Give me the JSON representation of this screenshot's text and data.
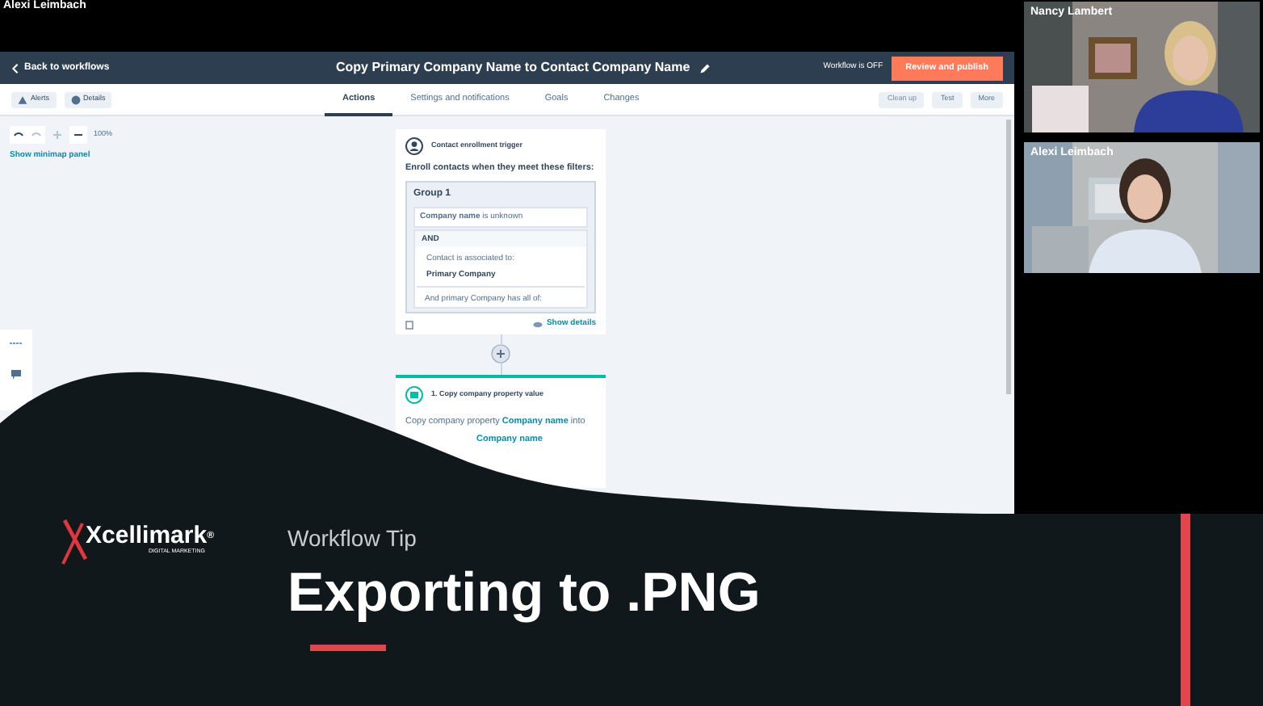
{
  "presenter_label": "Alexi Leimbach",
  "header": {
    "back": "Back to workflows",
    "title": "Copy Primary Company Name to Contact Company Name",
    "status": "Workflow is OFF",
    "publish": "Review and publish"
  },
  "toolbar": {
    "left": [
      {
        "label": "Alerts",
        "kind": "alert"
      },
      {
        "label": "Details",
        "kind": "info"
      }
    ],
    "tabs": [
      {
        "label": "Actions",
        "selected": true
      },
      {
        "label": "Settings and notifications",
        "selected": false
      },
      {
        "label": "Goals",
        "selected": false
      },
      {
        "label": "Changes",
        "selected": false
      }
    ],
    "right": [
      {
        "label": "Clean up",
        "disabled": true
      },
      {
        "label": "Test",
        "disabled": false
      },
      {
        "label": "More",
        "disabled": false
      }
    ]
  },
  "zoom": {
    "level": "100%"
  },
  "minimap_link": "Show minimap panel",
  "trigger": {
    "title": "Contact enrollment trigger",
    "subtitle": "Enroll contacts when they meet these filters:",
    "group": "Group 1",
    "filter": "**Company name** is unknown",
    "operator": "AND",
    "association": "Contact is associated to:",
    "association_value": "Primary Company",
    "condition": "And primary Company has all of:",
    "details_link": "Show details"
  },
  "action": {
    "title": "1. Copy company property value",
    "line_1": "Copy company property **Company name** into",
    "line_2": "Company name"
  },
  "participants": [
    {
      "name": "Nancy Lambert",
      "kind": "light"
    },
    {
      "name": "Alexi Leimbach",
      "kind": "dark"
    }
  ],
  "overlay": {
    "brand": "Xcellimark$^{®}$",
    "brand_sub": "DIGITAL MARKETING",
    "kicker": "Workflow Tip",
    "title": "Exporting to .PNG"
  }
}
